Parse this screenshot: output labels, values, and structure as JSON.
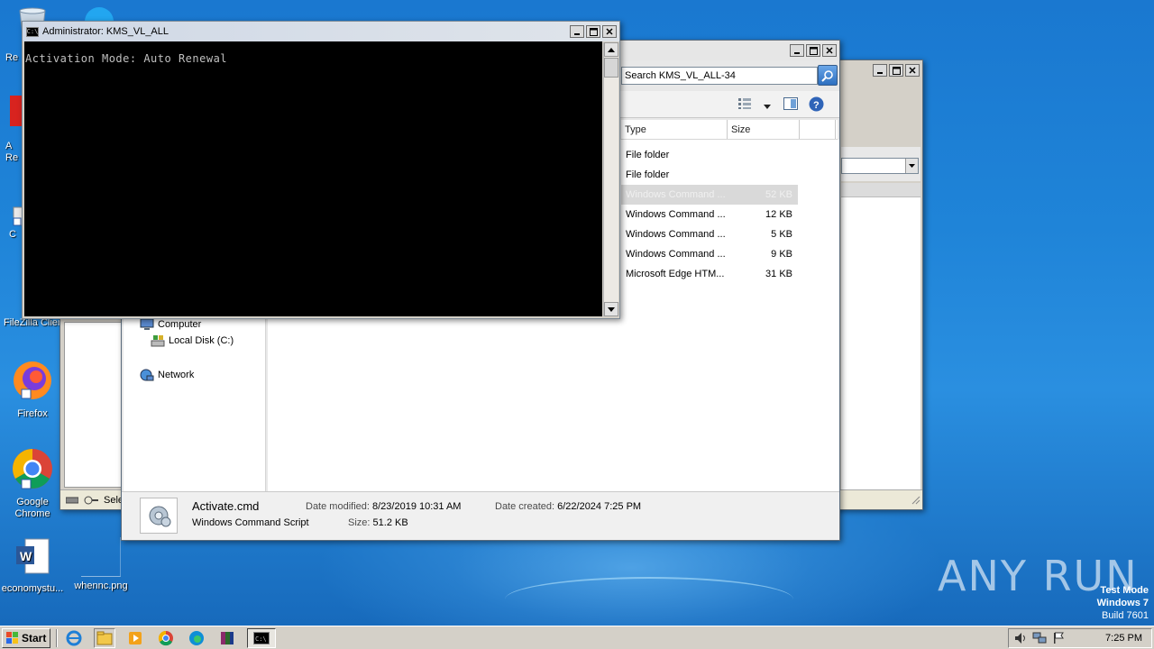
{
  "desktop": {
    "icons": [
      {
        "label": "Re",
        "name": "recycle-bin-icon"
      },
      {
        "label": "A\nRe",
        "name": "acrobat-reader-icon"
      },
      {
        "label": "C",
        "name": "ccleaner-icon"
      },
      {
        "label": "FileZilla Client",
        "name": "filezilla-icon"
      },
      {
        "label": "Firefox",
        "name": "firefox-icon"
      },
      {
        "label": "Google Chrome",
        "name": "chrome-icon"
      },
      {
        "label": "economystu...",
        "name": "word-document-icon"
      },
      {
        "label": "whennc.png",
        "name": "png-image-icon"
      }
    ]
  },
  "console": {
    "title": "Administrator:  KMS_VL_ALL",
    "icon_text": "C:\\",
    "output": "Activation Mode: Auto Renewal"
  },
  "explorer": {
    "search_placeholder": "Search KMS_VL_ALL-34",
    "columns": [
      "Type",
      "Size"
    ],
    "files": [
      {
        "type": "File folder",
        "size": ""
      },
      {
        "type": "File folder",
        "size": ""
      },
      {
        "type": "Windows Command ...",
        "size": "52 KB",
        "selected": true
      },
      {
        "type": "Windows Command ...",
        "size": "12 KB"
      },
      {
        "type": "Windows Command ...",
        "size": "5 KB"
      },
      {
        "type": "Windows Command ...",
        "size": "9 KB"
      },
      {
        "type": "Microsoft Edge HTM...",
        "size": "31 KB"
      }
    ],
    "nav": {
      "computer": "Computer",
      "local_disk": "Local Disk (C:)",
      "network": "Network"
    },
    "details": {
      "filename": "Activate.cmd",
      "filetype": "Windows Command Script",
      "date_modified_label": "Date modified:",
      "date_modified": "8/23/2019 10:31 AM",
      "date_created_label": "Date created:",
      "date_created": "6/22/2024 7:25 PM",
      "size_label": "Size:",
      "size": "51.2 KB"
    }
  },
  "back_window": {
    "status_text": "Sele"
  },
  "taskbar": {
    "start_label": "Start",
    "clock": "7:25 PM"
  },
  "overlay": {
    "watermark": "ANY RUN",
    "testmode_line1": "Test Mode",
    "testmode_line2": "Windows 7",
    "testmode_line3": "Build 7601"
  }
}
